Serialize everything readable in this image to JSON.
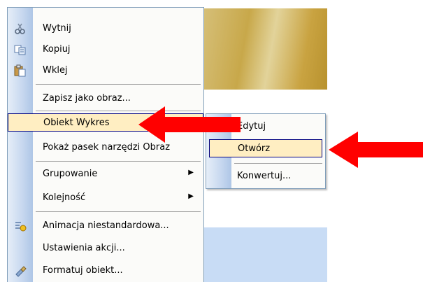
{
  "menu": {
    "items": [
      {
        "label": "Wytnij",
        "icon": "scissors-icon"
      },
      {
        "label": "Kopiuj",
        "icon": "copy-icon"
      },
      {
        "label": "Wklej",
        "icon": "paste-icon"
      },
      {
        "label": "Zapisz jako obraz..."
      },
      {
        "label": "Obiekt Wykres"
      },
      {
        "label": "Pokaż pasek narzędzi Obraz"
      },
      {
        "label": "Grupowanie",
        "submenu_arrow": "▶"
      },
      {
        "label": "Kolejność",
        "submenu_arrow": "▶"
      },
      {
        "label": "Animacja niestandardowa...",
        "icon": "animation-icon"
      },
      {
        "label": "Ustawienia akcji..."
      },
      {
        "label": "Formatuj obiekt...",
        "icon": "format-object-icon"
      }
    ],
    "highlighted_item": "Obiekt Wykres"
  },
  "submenu": {
    "items": [
      {
        "label": "Edytuj"
      },
      {
        "label": "Otwórz"
      },
      {
        "label": "Konwertuj..."
      }
    ],
    "highlighted_item": "Otwórz"
  },
  "colors": {
    "highlight": "#ffeec2",
    "highlight_border": "#000080",
    "arrow": "#ff0000",
    "gutter": "#c6d7ef"
  }
}
